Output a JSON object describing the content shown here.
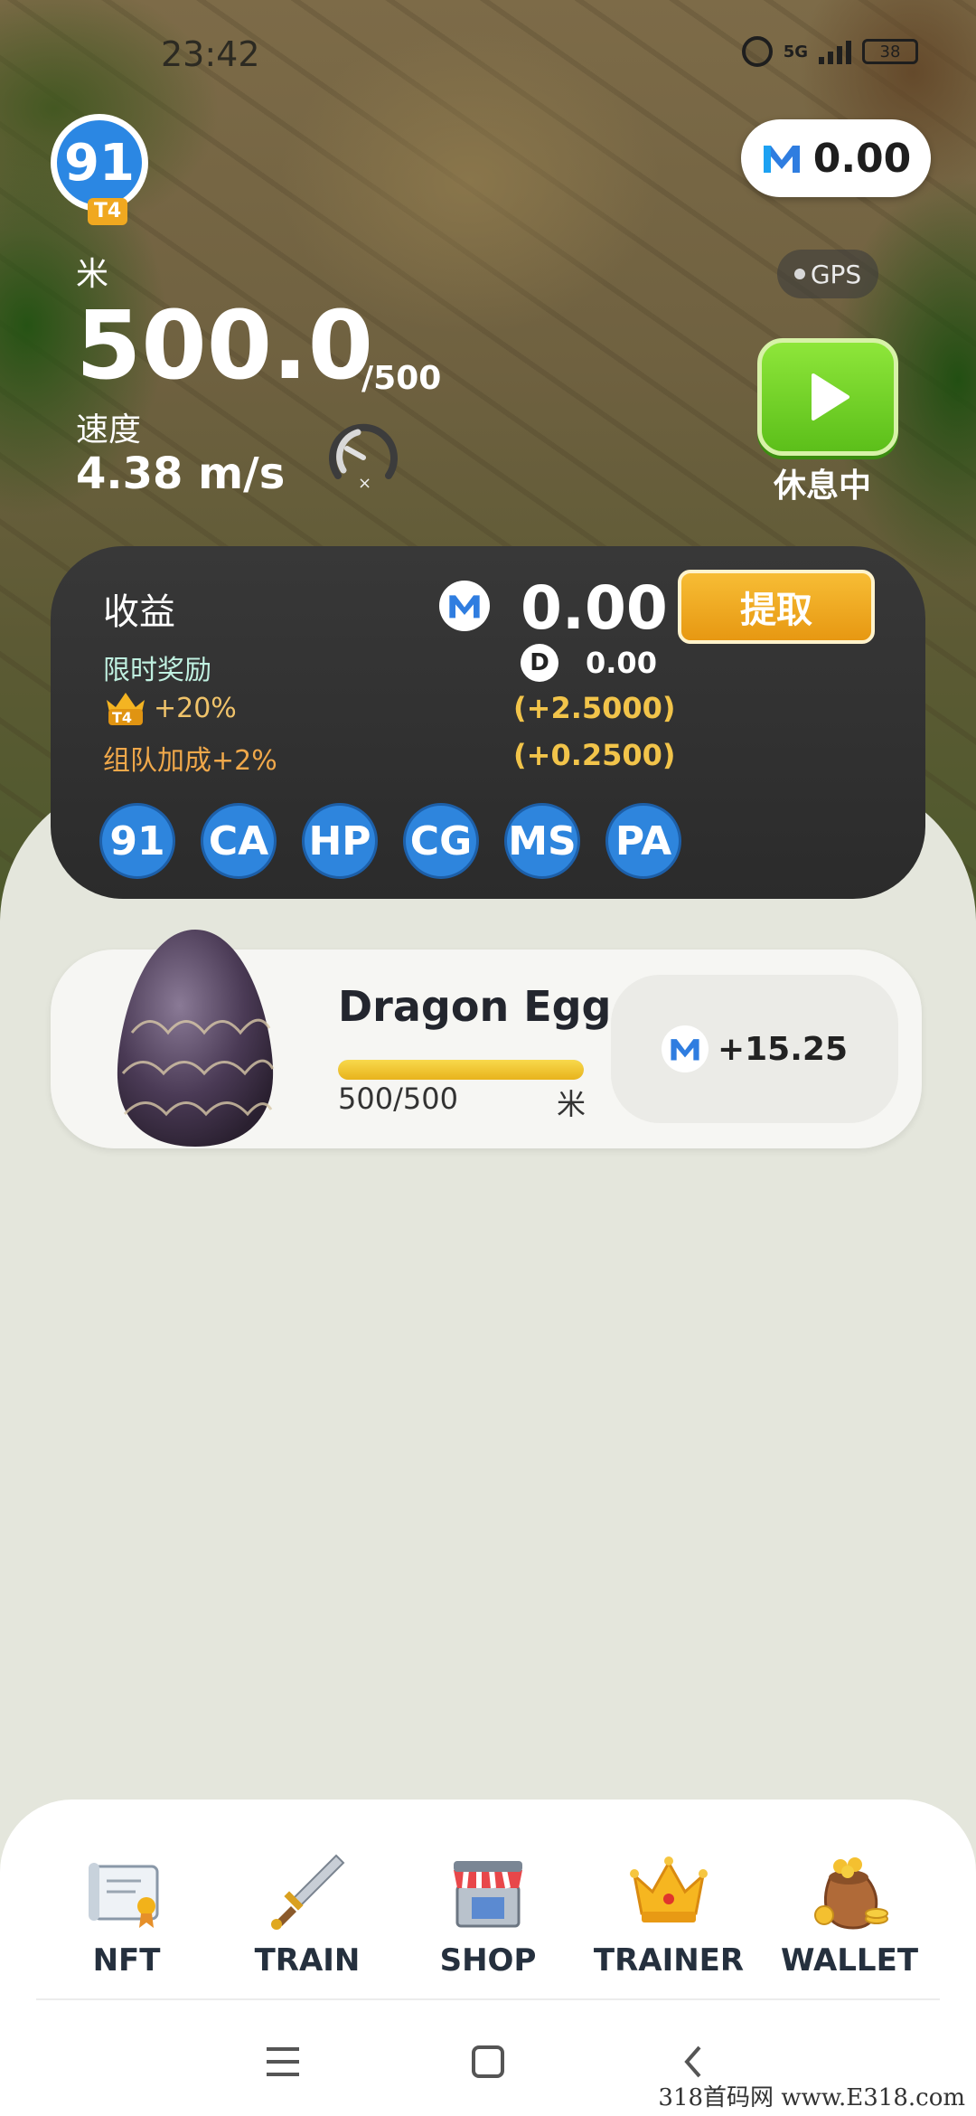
{
  "status_bar": {
    "time": "23:42",
    "network": "5G",
    "battery": "38"
  },
  "player": {
    "level": "91",
    "tier": "T4"
  },
  "balance": {
    "value": "0.00",
    "icon": "m-token-icon"
  },
  "gps": {
    "label": "GPS"
  },
  "distance": {
    "unit": "米",
    "value": "500.0",
    "max": "/500"
  },
  "speed": {
    "label": "速度",
    "value": "4.38 m/s"
  },
  "play": {
    "status": "休息中"
  },
  "earnings": {
    "title": "收益",
    "m_value": "0.00",
    "claim_label": "提取",
    "bonus_label": "限时奖励",
    "d_icon": "D",
    "d_value": "0.00",
    "tier_tag": "T4",
    "tier_bonus": "+20%",
    "tier_bonus_amount": "(+2.5000)",
    "team_bonus": "组队加成+2%",
    "team_bonus_amount": "(+0.2500)",
    "attributes": [
      "91",
      "CA",
      "HP",
      "CG",
      "MS",
      "PA"
    ]
  },
  "egg": {
    "title": "Dragon Egg",
    "progress_text": "500/500",
    "progress_fraction": 1.0,
    "unit": "米",
    "reward": "+15.25"
  },
  "nav": [
    {
      "label": "NFT",
      "icon": "certificate-icon"
    },
    {
      "label": "TRAIN",
      "icon": "sword-icon"
    },
    {
      "label": "SHOP",
      "icon": "shop-icon"
    },
    {
      "label": "TRAINER",
      "icon": "crown-icon"
    },
    {
      "label": "WALLET",
      "icon": "coin-bag-icon"
    }
  ],
  "watermark": "318首码网 www.E318.com",
  "colors": {
    "accent_blue": "#2e85dd",
    "claim_orange": "#e79812",
    "play_green": "#5cbf1a",
    "progress_yellow": "#e8b31c"
  }
}
